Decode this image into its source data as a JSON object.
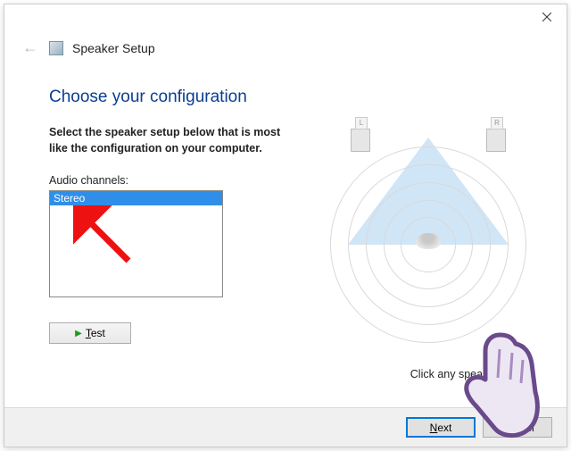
{
  "header": {
    "title": "Speaker Setup"
  },
  "main": {
    "page_title": "Choose your configuration",
    "instruction": "Select the speaker setup below that is most like the configuration on your computer.",
    "channels_label": "Audio channels:",
    "channels": [
      "Stereo"
    ],
    "selected_channel": "Stereo",
    "test_label": "Test",
    "hint": "Click any speaker abov"
  },
  "speakers": {
    "left": "L",
    "right": "R"
  },
  "footer": {
    "next_label": "Next",
    "cancel_label": "Cancel"
  }
}
